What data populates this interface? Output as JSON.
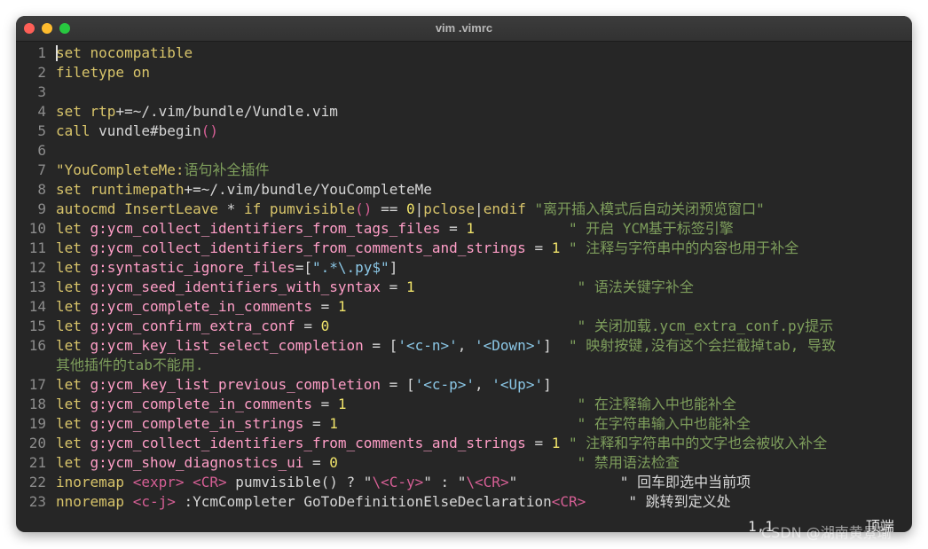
{
  "window": {
    "title": "vim .vimrc"
  },
  "lines": [
    {
      "num": "1",
      "segments": [
        {
          "t": "set ",
          "c": "k"
        },
        {
          "t": "nocompatible",
          "c": "k"
        }
      ]
    },
    {
      "num": "2",
      "segments": [
        {
          "t": "filetype ",
          "c": "k"
        },
        {
          "t": "on",
          "c": "k"
        }
      ]
    },
    {
      "num": "3",
      "segments": []
    },
    {
      "num": "4",
      "segments": [
        {
          "t": "set ",
          "c": "k"
        },
        {
          "t": "rtp",
          "c": "k"
        },
        {
          "t": "+=~/.vim/bundle/Vundle.vim",
          "c": "o"
        }
      ]
    },
    {
      "num": "5",
      "segments": [
        {
          "t": "call ",
          "c": "k"
        },
        {
          "t": "vundle#begin",
          "c": "o"
        },
        {
          "t": "()",
          "c": "sp"
        }
      ]
    },
    {
      "num": "6",
      "segments": []
    },
    {
      "num": "7",
      "segments": [
        {
          "t": "\"YouCompleteMe:",
          "c": "k"
        },
        {
          "t": "语句补全插件",
          "c": "c"
        }
      ]
    },
    {
      "num": "8",
      "segments": [
        {
          "t": "set ",
          "c": "k"
        },
        {
          "t": "runtimepath",
          "c": "k"
        },
        {
          "t": "+=~/.vim/bundle/YouCompleteMe",
          "c": "o"
        }
      ]
    },
    {
      "num": "9",
      "segments": [
        {
          "t": "autocmd ",
          "c": "k"
        },
        {
          "t": "InsertLeave",
          "c": "k"
        },
        {
          "t": " * ",
          "c": "o"
        },
        {
          "t": "if ",
          "c": "k"
        },
        {
          "t": "pumvisible",
          "c": "k"
        },
        {
          "t": "()",
          "c": "sp"
        },
        {
          "t": " == ",
          "c": "o"
        },
        {
          "t": "0",
          "c": "n"
        },
        {
          "t": "|",
          "c": "o"
        },
        {
          "t": "pclose",
          "c": "k"
        },
        {
          "t": "|",
          "c": "o"
        },
        {
          "t": "endif ",
          "c": "k"
        },
        {
          "t": "\"离开插入模式后自动关闭预览窗口\"",
          "c": "c"
        }
      ]
    },
    {
      "num": "10",
      "segments": [
        {
          "t": "let ",
          "c": "k"
        },
        {
          "t": "g:ycm_collect_identifiers_from_tags_files",
          "c": "v"
        },
        {
          "t": " = ",
          "c": "o"
        },
        {
          "t": "1",
          "c": "n"
        },
        {
          "t": "           \" 开启 YCM基于标签引擎",
          "c": "c"
        }
      ]
    },
    {
      "num": "11",
      "segments": [
        {
          "t": "let ",
          "c": "k"
        },
        {
          "t": "g:ycm_collect_identifiers_from_comments_and_strings",
          "c": "v"
        },
        {
          "t": " = ",
          "c": "o"
        },
        {
          "t": "1",
          "c": "n"
        },
        {
          "t": " \" 注释与字符串中的内容也用于补全",
          "c": "c"
        }
      ]
    },
    {
      "num": "12",
      "segments": [
        {
          "t": "let ",
          "c": "k"
        },
        {
          "t": "g:syntastic_ignore_files",
          "c": "v"
        },
        {
          "t": "=[",
          "c": "o"
        },
        {
          "t": "\".*\\.py$\"",
          "c": "s"
        },
        {
          "t": "]",
          "c": "o"
        }
      ]
    },
    {
      "num": "13",
      "segments": [
        {
          "t": "let ",
          "c": "k"
        },
        {
          "t": "g:ycm_seed_identifiers_with_syntax",
          "c": "v"
        },
        {
          "t": " = ",
          "c": "o"
        },
        {
          "t": "1",
          "c": "n"
        },
        {
          "t": "                   \" 语法关键字补全",
          "c": "c"
        }
      ]
    },
    {
      "num": "14",
      "segments": [
        {
          "t": "let ",
          "c": "k"
        },
        {
          "t": "g:ycm_complete_in_comments",
          "c": "v"
        },
        {
          "t": " = ",
          "c": "o"
        },
        {
          "t": "1",
          "c": "n"
        }
      ]
    },
    {
      "num": "15",
      "segments": [
        {
          "t": "let ",
          "c": "k"
        },
        {
          "t": "g:ycm_confirm_extra_conf",
          "c": "v"
        },
        {
          "t": " = ",
          "c": "o"
        },
        {
          "t": "0",
          "c": "n"
        },
        {
          "t": "                             \" 关闭加载.ycm_extra_conf.py提示",
          "c": "c"
        }
      ]
    },
    {
      "num": "16",
      "segments": [
        {
          "t": "let ",
          "c": "k"
        },
        {
          "t": "g:ycm_key_list_select_completion",
          "c": "v"
        },
        {
          "t": " = [",
          "c": "o"
        },
        {
          "t": "'<c-n>'",
          "c": "s"
        },
        {
          "t": ", ",
          "c": "o"
        },
        {
          "t": "'<Down>'",
          "c": "s"
        },
        {
          "t": "]",
          "c": "o"
        },
        {
          "t": "  \" 映射按键,没有这个会拦截掉tab, 导致",
          "c": "c"
        }
      ],
      "wrap": "其他插件的tab不能用."
    },
    {
      "num": "17",
      "segments": [
        {
          "t": "let ",
          "c": "k"
        },
        {
          "t": "g:ycm_key_list_previous_completion",
          "c": "v"
        },
        {
          "t": " = [",
          "c": "o"
        },
        {
          "t": "'<c-p>'",
          "c": "s"
        },
        {
          "t": ", ",
          "c": "o"
        },
        {
          "t": "'<Up>'",
          "c": "s"
        },
        {
          "t": "]",
          "c": "o"
        }
      ]
    },
    {
      "num": "18",
      "segments": [
        {
          "t": "let ",
          "c": "k"
        },
        {
          "t": "g:ycm_complete_in_comments",
          "c": "v"
        },
        {
          "t": " = ",
          "c": "o"
        },
        {
          "t": "1",
          "c": "n"
        },
        {
          "t": "                           \" 在注释输入中也能补全",
          "c": "c"
        }
      ]
    },
    {
      "num": "19",
      "segments": [
        {
          "t": "let ",
          "c": "k"
        },
        {
          "t": "g:ycm_complete_in_strings",
          "c": "v"
        },
        {
          "t": " = ",
          "c": "o"
        },
        {
          "t": "1",
          "c": "n"
        },
        {
          "t": "                            \" 在字符串输入中也能补全",
          "c": "c"
        }
      ]
    },
    {
      "num": "20",
      "segments": [
        {
          "t": "let ",
          "c": "k"
        },
        {
          "t": "g:ycm_collect_identifiers_from_comments_and_strings",
          "c": "v"
        },
        {
          "t": " = ",
          "c": "o"
        },
        {
          "t": "1",
          "c": "n"
        },
        {
          "t": " \" 注释和字符串中的文字也会被收入补全",
          "c": "c"
        }
      ]
    },
    {
      "num": "21",
      "segments": [
        {
          "t": "let ",
          "c": "k"
        },
        {
          "t": "g:ycm_show_diagnostics_ui",
          "c": "v"
        },
        {
          "t": " = ",
          "c": "o"
        },
        {
          "t": "0",
          "c": "n"
        },
        {
          "t": "                            \" 禁用语法检查",
          "c": "c"
        }
      ]
    },
    {
      "num": "22",
      "segments": [
        {
          "t": "inoremap ",
          "c": "k"
        },
        {
          "t": "<expr>",
          "c": "sp"
        },
        {
          "t": " ",
          "c": "o"
        },
        {
          "t": "<CR>",
          "c": "sp"
        },
        {
          "t": " pumvisible() ? \"",
          "c": "o"
        },
        {
          "t": "\\<C-y>",
          "c": "sp"
        },
        {
          "t": "\" : \"",
          "c": "o"
        },
        {
          "t": "\\<CR>",
          "c": "sp"
        },
        {
          "t": "\"            \" 回车即选中当前项",
          "c": "o"
        }
      ]
    },
    {
      "num": "23",
      "segments": [
        {
          "t": "nnoremap ",
          "c": "k"
        },
        {
          "t": "<c-j>",
          "c": "sp"
        },
        {
          "t": " :YcmCompleter GoToDefinitionElseDeclaration",
          "c": "o"
        },
        {
          "t": "<CR>",
          "c": "sp"
        },
        {
          "t": "     \" 跳转到定义处",
          "c": "o"
        }
      ]
    }
  ],
  "status": {
    "position": "1,1",
    "scroll": "顶端"
  },
  "watermark": "CSDN @湖南黄景瑜"
}
